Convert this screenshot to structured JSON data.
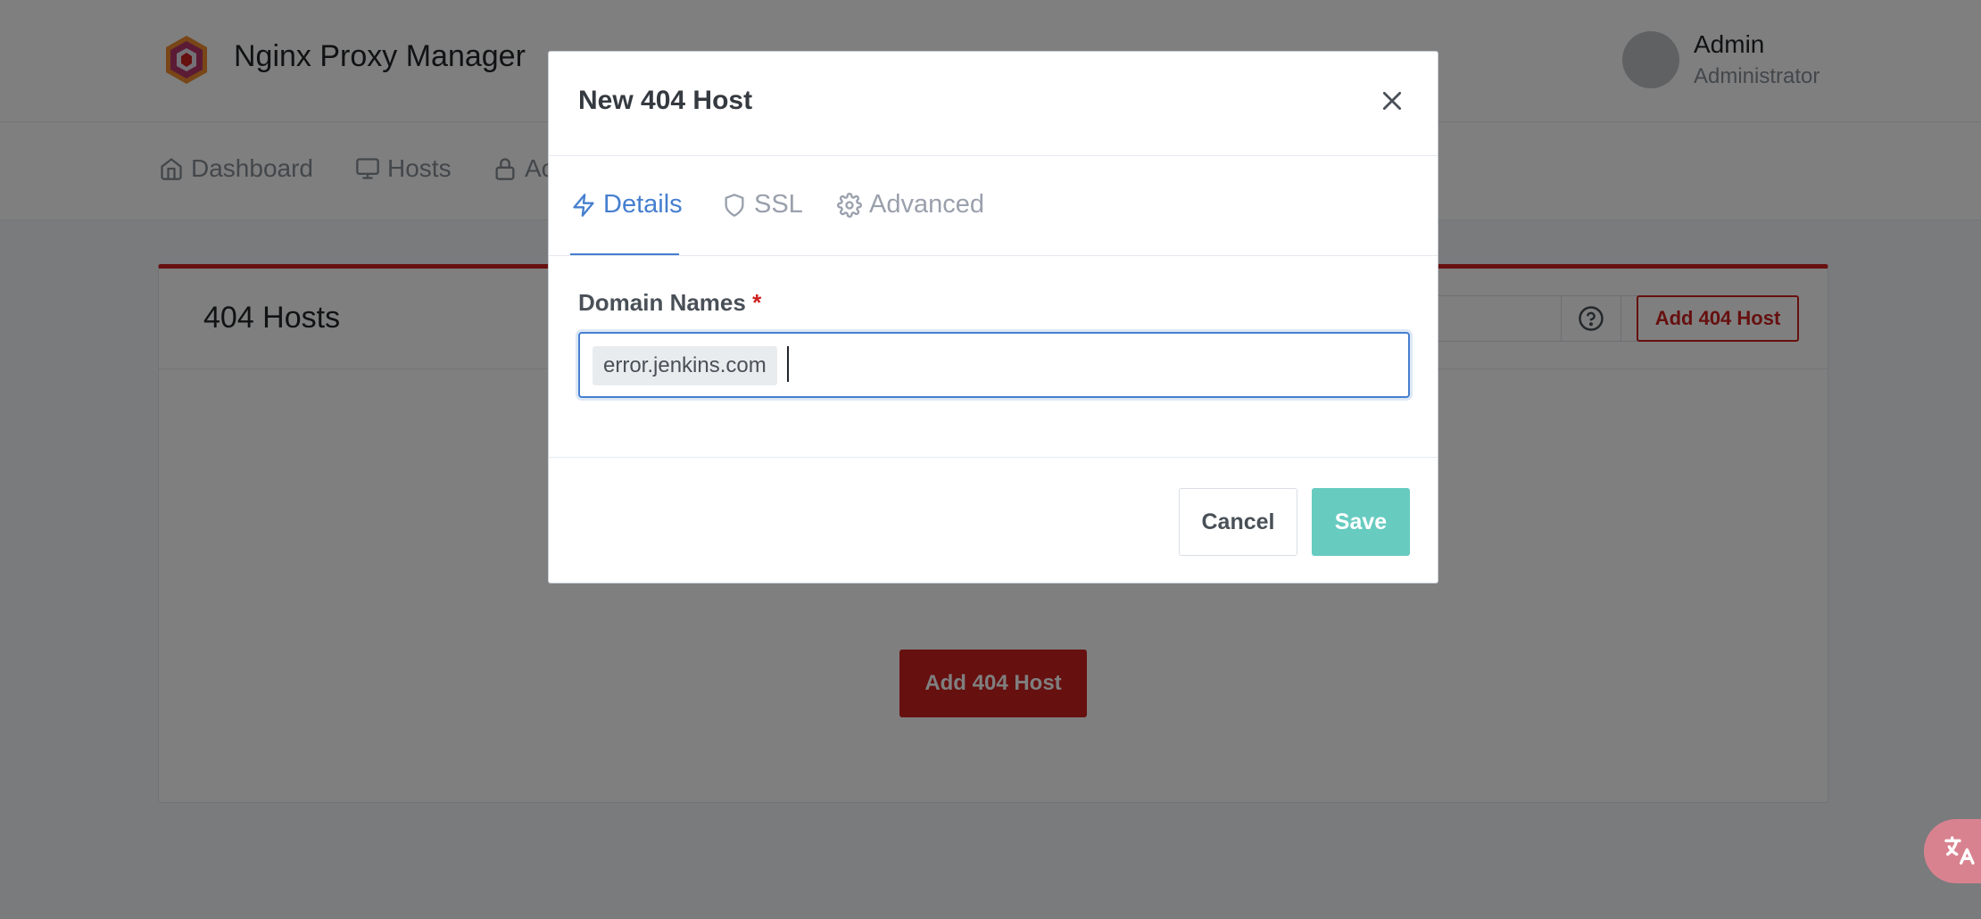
{
  "app": {
    "brand": "Nginx Proxy Manager",
    "user_name": "Admin",
    "user_role": "Administrator"
  },
  "nav": {
    "items": [
      {
        "label": "Dashboard",
        "icon": "home-icon"
      },
      {
        "label": "Hosts",
        "icon": "monitor-icon"
      },
      {
        "label": "Ac",
        "icon": "lock-icon"
      }
    ]
  },
  "page": {
    "title": "404 Hosts",
    "add_button_label": "Add 404 Host",
    "add_button_center_label": "Add 404 Host",
    "help_icon": "help-circle-icon"
  },
  "modal": {
    "title": "New 404 Host",
    "tabs": [
      {
        "label": "Details",
        "icon": "zap-icon",
        "active": true
      },
      {
        "label": "SSL",
        "icon": "shield-icon",
        "active": false
      },
      {
        "label": "Advanced",
        "icon": "settings-icon",
        "active": false
      }
    ],
    "domain_label": "Domain Names",
    "required_marker": "*",
    "domain_values": [
      "error.jenkins.com"
    ],
    "cancel_label": "Cancel",
    "save_label": "Save"
  },
  "colors": {
    "accent": "#467fcf",
    "danger": "#cd201f",
    "save": "#67cbc0"
  }
}
